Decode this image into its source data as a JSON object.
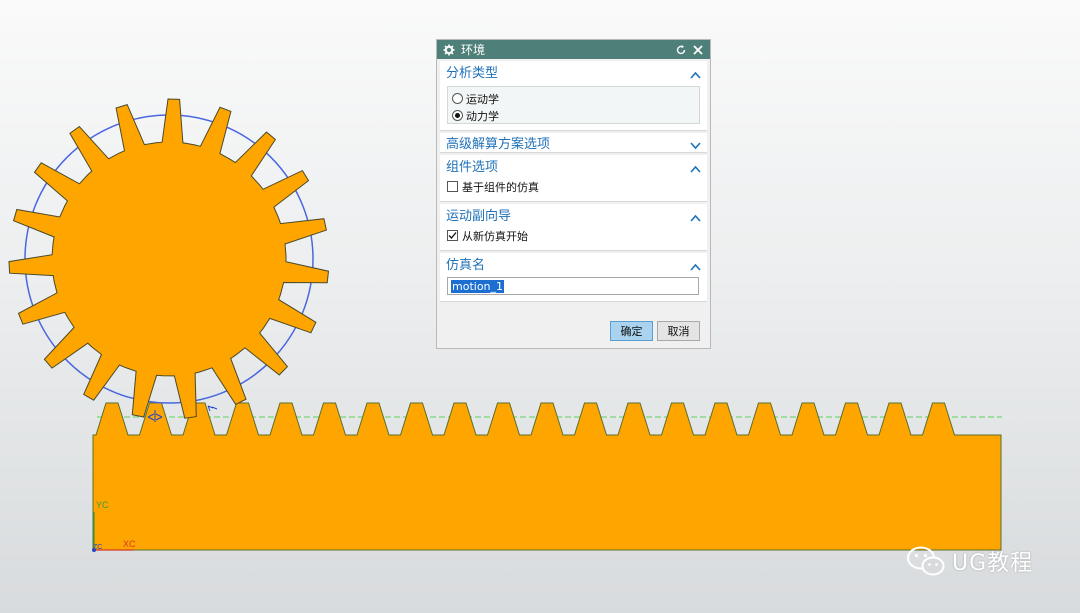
{
  "dialog": {
    "title": "环境",
    "title_icon": "gear-icon",
    "sections": {
      "analysis": {
        "label": "分析类型",
        "options": [
          "运动学",
          "动力学"
        ],
        "selected": "动力学"
      },
      "advanced": {
        "label": "高级解算方案选项",
        "expanded": false
      },
      "component": {
        "label": "组件选项",
        "checkbox_label": "基于组件的仿真",
        "checked": false
      },
      "wizard": {
        "label": "运动副向导",
        "checkbox_label": "从新仿真开始",
        "checked": true
      },
      "sim_name": {
        "label": "仿真名",
        "value": "motion_1"
      }
    },
    "ok_label": "确定",
    "cancel_label": "取消"
  },
  "axes": {
    "yc_label": "YC",
    "xc_label": "XC",
    "zc_label": "ZC"
  },
  "watermark": {
    "text": "UG教程",
    "icon": "wechat-icon"
  },
  "colors": {
    "part_fill": "#ffa500",
    "pitch_circle": "#4a67e0",
    "pitch_line": "#5fd35f",
    "titlebar": "#4f7f79",
    "accent_text": "#1f72b8"
  }
}
